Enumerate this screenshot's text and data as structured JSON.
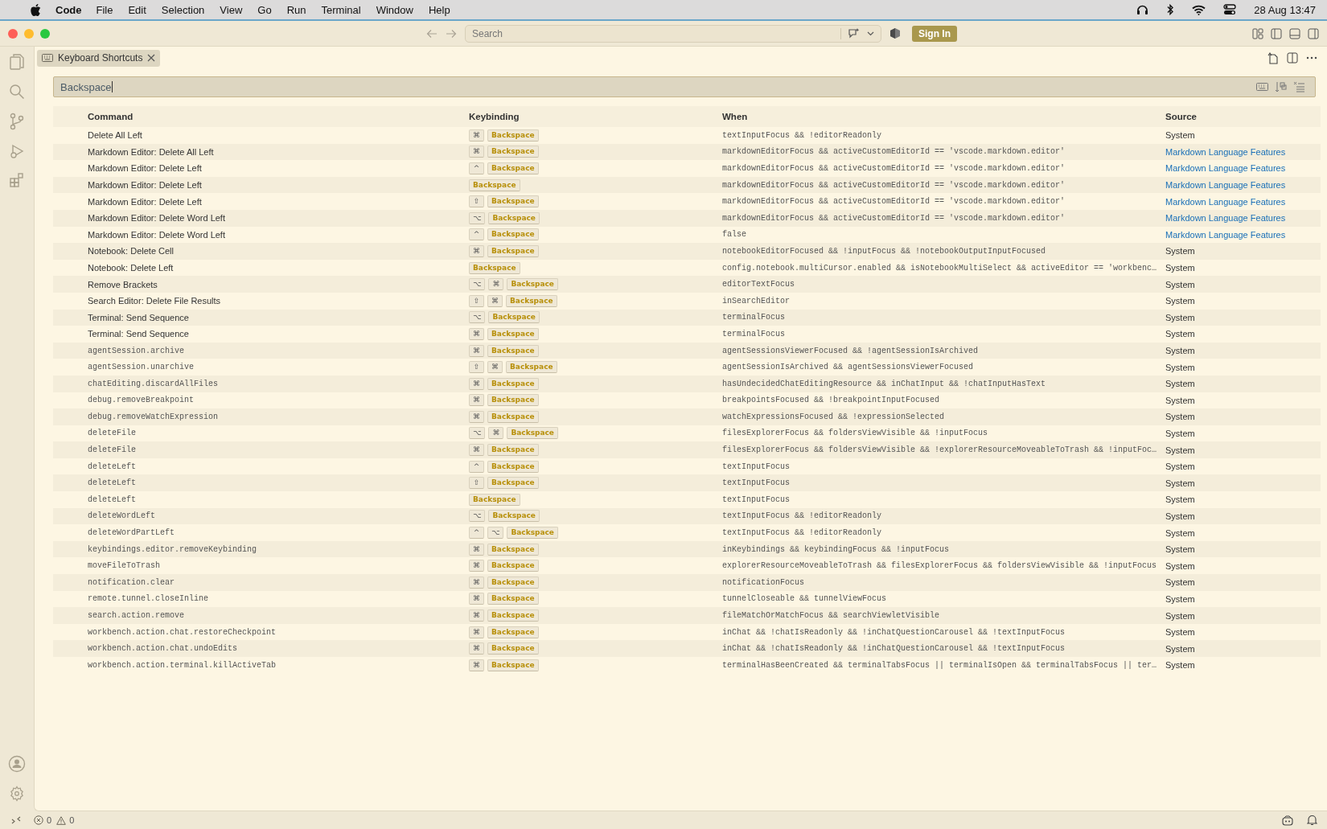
{
  "menu_bar": {
    "app": "Code",
    "items": [
      "File",
      "Edit",
      "Selection",
      "View",
      "Go",
      "Run",
      "Terminal",
      "Window",
      "Help"
    ],
    "clock": "28 Aug  13:47"
  },
  "title_bar": {
    "search": {
      "placeholder": "Search"
    },
    "sign_in": "Sign In"
  },
  "tab": {
    "label": "Keyboard Shortcuts",
    "selected": true
  },
  "search": {
    "value": "Backspace"
  },
  "table": {
    "columns": [
      "Command",
      "Keybinding",
      "When",
      "Source"
    ],
    "rows": [
      {
        "command": "Delete All Left",
        "kind": "title",
        "keys": [
          {
            "kind": "modifier",
            "label": "⌘"
          },
          {
            "kind": "key",
            "label": "Backspace"
          }
        ],
        "when": "textInputFocus && !editorReadonly",
        "source": {
          "kind": "system",
          "label": "System"
        }
      },
      {
        "command": "Markdown Editor: Delete All Left",
        "kind": "title",
        "keys": [
          {
            "kind": "modifier",
            "label": "⌘"
          },
          {
            "kind": "key",
            "label": "Backspace"
          }
        ],
        "when": "markdownEditorFocus && activeCustomEditorId == 'vscode.markdown.editor'",
        "source": {
          "kind": "extension",
          "label": "Markdown Language Features"
        }
      },
      {
        "command": "Markdown Editor: Delete Left",
        "kind": "title",
        "keys": [
          {
            "kind": "modifier",
            "label": "^"
          },
          {
            "kind": "key",
            "label": "Backspace"
          }
        ],
        "when": "markdownEditorFocus && activeCustomEditorId == 'vscode.markdown.editor'",
        "source": {
          "kind": "extension",
          "label": "Markdown Language Features"
        }
      },
      {
        "command": "Markdown Editor: Delete Left",
        "kind": "title",
        "keys": [
          {
            "kind": "key",
            "label": "Backspace"
          }
        ],
        "when": "markdownEditorFocus && activeCustomEditorId == 'vscode.markdown.editor'",
        "source": {
          "kind": "extension",
          "label": "Markdown Language Features"
        }
      },
      {
        "command": "Markdown Editor: Delete Left",
        "kind": "title",
        "keys": [
          {
            "kind": "modifier",
            "label": "⇧"
          },
          {
            "kind": "key",
            "label": "Backspace"
          }
        ],
        "when": "markdownEditorFocus && activeCustomEditorId == 'vscode.markdown.editor'",
        "source": {
          "kind": "extension",
          "label": "Markdown Language Features"
        }
      },
      {
        "command": "Markdown Editor: Delete Word Left",
        "kind": "title",
        "keys": [
          {
            "kind": "modifier",
            "label": "⌥"
          },
          {
            "kind": "key",
            "label": "Backspace"
          }
        ],
        "when": "markdownEditorFocus && activeCustomEditorId == 'vscode.markdown.editor'",
        "source": {
          "kind": "extension",
          "label": "Markdown Language Features"
        }
      },
      {
        "command": "Markdown Editor: Delete Word Left",
        "kind": "title",
        "keys": [
          {
            "kind": "modifier",
            "label": "^"
          },
          {
            "kind": "key",
            "label": "Backspace"
          }
        ],
        "when": "false",
        "source": {
          "kind": "extension",
          "label": "Markdown Language Features"
        }
      },
      {
        "command": "Notebook: Delete Cell",
        "kind": "title",
        "keys": [
          {
            "kind": "modifier",
            "label": "⌘"
          },
          {
            "kind": "key",
            "label": "Backspace"
          }
        ],
        "when": "notebookEditorFocused && !inputFocus && !notebookOutputInputFocused",
        "source": {
          "kind": "system",
          "label": "System"
        }
      },
      {
        "command": "Notebook: Delete Left",
        "kind": "title",
        "keys": [
          {
            "kind": "key",
            "label": "Backspace"
          }
        ],
        "when": "config.notebook.multiCursor.enabled && isNotebookMultiSelect && activeEditor == 'workbenc…",
        "source": {
          "kind": "system",
          "label": "System"
        }
      },
      {
        "command": "Remove Brackets",
        "kind": "title",
        "keys": [
          {
            "kind": "modifier",
            "label": "⌥"
          },
          {
            "kind": "modifier",
            "label": "⌘"
          },
          {
            "kind": "key",
            "label": "Backspace"
          }
        ],
        "when": "editorTextFocus",
        "source": {
          "kind": "system",
          "label": "System"
        }
      },
      {
        "command": "Search Editor: Delete File Results",
        "kind": "title",
        "keys": [
          {
            "kind": "modifier",
            "label": "⇧"
          },
          {
            "kind": "modifier",
            "label": "⌘"
          },
          {
            "kind": "key",
            "label": "Backspace"
          }
        ],
        "when": "inSearchEditor",
        "source": {
          "kind": "system",
          "label": "System"
        }
      },
      {
        "command": "Terminal: Send Sequence",
        "kind": "title",
        "keys": [
          {
            "kind": "modifier",
            "label": "⌥"
          },
          {
            "kind": "key",
            "label": "Backspace"
          }
        ],
        "when": "terminalFocus",
        "source": {
          "kind": "system",
          "label": "System"
        }
      },
      {
        "command": "Terminal: Send Sequence",
        "kind": "title",
        "keys": [
          {
            "kind": "modifier",
            "label": "⌘"
          },
          {
            "kind": "key",
            "label": "Backspace"
          }
        ],
        "when": "terminalFocus",
        "source": {
          "kind": "system",
          "label": "System"
        }
      },
      {
        "command": "agentSession.archive",
        "kind": "id",
        "keys": [
          {
            "kind": "modifier",
            "label": "⌘"
          },
          {
            "kind": "key",
            "label": "Backspace"
          }
        ],
        "when": "agentSessionsViewerFocused && !agentSessionIsArchived",
        "source": {
          "kind": "system",
          "label": "System"
        }
      },
      {
        "command": "agentSession.unarchive",
        "kind": "id",
        "keys": [
          {
            "kind": "modifier",
            "label": "⇧"
          },
          {
            "kind": "modifier",
            "label": "⌘"
          },
          {
            "kind": "key",
            "label": "Backspace"
          }
        ],
        "when": "agentSessionIsArchived && agentSessionsViewerFocused",
        "source": {
          "kind": "system",
          "label": "System"
        }
      },
      {
        "command": "chatEditing.discardAllFiles",
        "kind": "id",
        "keys": [
          {
            "kind": "modifier",
            "label": "⌘"
          },
          {
            "kind": "key",
            "label": "Backspace"
          }
        ],
        "when": "hasUndecidedChatEditingResource && inChatInput && !chatInputHasText",
        "source": {
          "kind": "system",
          "label": "System"
        }
      },
      {
        "command": "debug.removeBreakpoint",
        "kind": "id",
        "keys": [
          {
            "kind": "modifier",
            "label": "⌘"
          },
          {
            "kind": "key",
            "label": "Backspace"
          }
        ],
        "when": "breakpointsFocused && !breakpointInputFocused",
        "source": {
          "kind": "system",
          "label": "System"
        }
      },
      {
        "command": "debug.removeWatchExpression",
        "kind": "id",
        "keys": [
          {
            "kind": "modifier",
            "label": "⌘"
          },
          {
            "kind": "key",
            "label": "Backspace"
          }
        ],
        "when": "watchExpressionsFocused && !expressionSelected",
        "source": {
          "kind": "system",
          "label": "System"
        }
      },
      {
        "command": "deleteFile",
        "kind": "id",
        "keys": [
          {
            "kind": "modifier",
            "label": "⌥"
          },
          {
            "kind": "modifier",
            "label": "⌘"
          },
          {
            "kind": "key",
            "label": "Backspace"
          }
        ],
        "when": "filesExplorerFocus && foldersViewVisible && !inputFocus",
        "source": {
          "kind": "system",
          "label": "System"
        }
      },
      {
        "command": "deleteFile",
        "kind": "id",
        "keys": [
          {
            "kind": "modifier",
            "label": "⌘"
          },
          {
            "kind": "key",
            "label": "Backspace"
          }
        ],
        "when": "filesExplorerFocus && foldersViewVisible && !explorerResourceMoveableToTrash && !inputFoc…",
        "source": {
          "kind": "system",
          "label": "System"
        }
      },
      {
        "command": "deleteLeft",
        "kind": "id",
        "keys": [
          {
            "kind": "modifier",
            "label": "^"
          },
          {
            "kind": "key",
            "label": "Backspace"
          }
        ],
        "when": "textInputFocus",
        "source": {
          "kind": "system",
          "label": "System"
        }
      },
      {
        "command": "deleteLeft",
        "kind": "id",
        "keys": [
          {
            "kind": "modifier",
            "label": "⇧"
          },
          {
            "kind": "key",
            "label": "Backspace"
          }
        ],
        "when": "textInputFocus",
        "source": {
          "kind": "system",
          "label": "System"
        }
      },
      {
        "command": "deleteLeft",
        "kind": "id",
        "keys": [
          {
            "kind": "key",
            "label": "Backspace"
          }
        ],
        "when": "textInputFocus",
        "source": {
          "kind": "system",
          "label": "System"
        }
      },
      {
        "command": "deleteWordLeft",
        "kind": "id",
        "keys": [
          {
            "kind": "modifier",
            "label": "⌥"
          },
          {
            "kind": "key",
            "label": "Backspace"
          }
        ],
        "when": "textInputFocus && !editorReadonly",
        "source": {
          "kind": "system",
          "label": "System"
        }
      },
      {
        "command": "deleteWordPartLeft",
        "kind": "id",
        "keys": [
          {
            "kind": "modifier",
            "label": "^"
          },
          {
            "kind": "modifier",
            "label": "⌥"
          },
          {
            "kind": "key",
            "label": "Backspace"
          }
        ],
        "when": "textInputFocus && !editorReadonly",
        "source": {
          "kind": "system",
          "label": "System"
        }
      },
      {
        "command": "keybindings.editor.removeKeybinding",
        "kind": "id",
        "keys": [
          {
            "kind": "modifier",
            "label": "⌘"
          },
          {
            "kind": "key",
            "label": "Backspace"
          }
        ],
        "when": "inKeybindings && keybindingFocus && !inputFocus",
        "source": {
          "kind": "system",
          "label": "System"
        }
      },
      {
        "command": "moveFileToTrash",
        "kind": "id",
        "keys": [
          {
            "kind": "modifier",
            "label": "⌘"
          },
          {
            "kind": "key",
            "label": "Backspace"
          }
        ],
        "when": "explorerResourceMoveableToTrash && filesExplorerFocus && foldersViewVisible && !inputFocus",
        "source": {
          "kind": "system",
          "label": "System"
        }
      },
      {
        "command": "notification.clear",
        "kind": "id",
        "keys": [
          {
            "kind": "modifier",
            "label": "⌘"
          },
          {
            "kind": "key",
            "label": "Backspace"
          }
        ],
        "when": "notificationFocus",
        "source": {
          "kind": "system",
          "label": "System"
        }
      },
      {
        "command": "remote.tunnel.closeInline",
        "kind": "id",
        "keys": [
          {
            "kind": "modifier",
            "label": "⌘"
          },
          {
            "kind": "key",
            "label": "Backspace"
          }
        ],
        "when": "tunnelCloseable && tunnelViewFocus",
        "source": {
          "kind": "system",
          "label": "System"
        }
      },
      {
        "command": "search.action.remove",
        "kind": "id",
        "keys": [
          {
            "kind": "modifier",
            "label": "⌘"
          },
          {
            "kind": "key",
            "label": "Backspace"
          }
        ],
        "when": "fileMatchOrMatchFocus && searchViewletVisible",
        "source": {
          "kind": "system",
          "label": "System"
        }
      },
      {
        "command": "workbench.action.chat.restoreCheckpoint",
        "kind": "id",
        "keys": [
          {
            "kind": "modifier",
            "label": "⌘"
          },
          {
            "kind": "key",
            "label": "Backspace"
          }
        ],
        "when": "inChat && !chatIsReadonly && !inChatQuestionCarousel && !textInputFocus",
        "source": {
          "kind": "system",
          "label": "System"
        }
      },
      {
        "command": "workbench.action.chat.undoEdits",
        "kind": "id",
        "keys": [
          {
            "kind": "modifier",
            "label": "⌘"
          },
          {
            "kind": "key",
            "label": "Backspace"
          }
        ],
        "when": "inChat && !chatIsReadonly && !inChatQuestionCarousel && !textInputFocus",
        "source": {
          "kind": "system",
          "label": "System"
        }
      },
      {
        "command": "workbench.action.terminal.killActiveTab",
        "kind": "id",
        "keys": [
          {
            "kind": "modifier",
            "label": "⌘"
          },
          {
            "kind": "key",
            "label": "Backspace"
          }
        ],
        "when": "terminalHasBeenCreated && terminalTabsFocus || terminalIsOpen && terminalTabsFocus || ter…",
        "source": {
          "kind": "system",
          "label": "System"
        }
      }
    ]
  },
  "status_bar": {
    "errors": "0",
    "warnings": "0"
  }
}
